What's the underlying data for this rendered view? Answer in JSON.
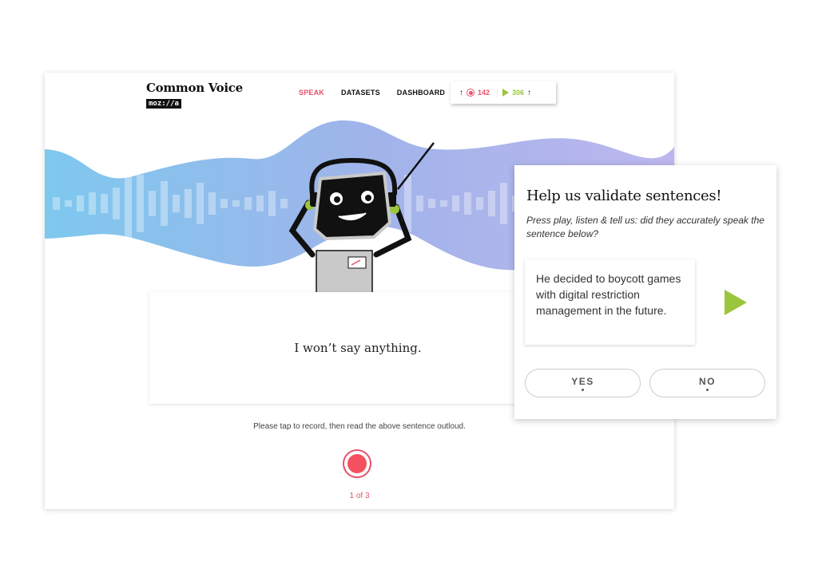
{
  "header": {
    "logo_title": "Common Voice",
    "logo_badge": "moz://a",
    "nav": [
      {
        "label": "SPEAK",
        "active": true
      },
      {
        "label": "DATASETS",
        "active": false
      },
      {
        "label": "DASHBOARD",
        "active": false
      }
    ],
    "stats": {
      "speak_count": "142",
      "listen_count": "306",
      "speak_icon": "record-icon",
      "listen_icon": "play-icon",
      "arrow_icon": "arrow-up-icon"
    }
  },
  "speak": {
    "sentence": "I won’t say anything.",
    "instruction": "Please tap to record, then read the above sentence outloud.",
    "progress": "1 of 3",
    "record_icon": "record-icon"
  },
  "validate": {
    "title": "Help us validate sentences!",
    "subtitle": "Press play, listen & tell us: did they accurately speak the sentence below?",
    "sentence": "He decided to boycott games with digital restriction management in the future.",
    "play_icon": "play-icon",
    "yes_label": "YES",
    "no_label": "NO"
  },
  "colors": {
    "accent_red": "#e8516b",
    "accent_green": "#9bc53d",
    "wave_left": "#7ec8ee",
    "wave_right": "#b5b4ec"
  }
}
